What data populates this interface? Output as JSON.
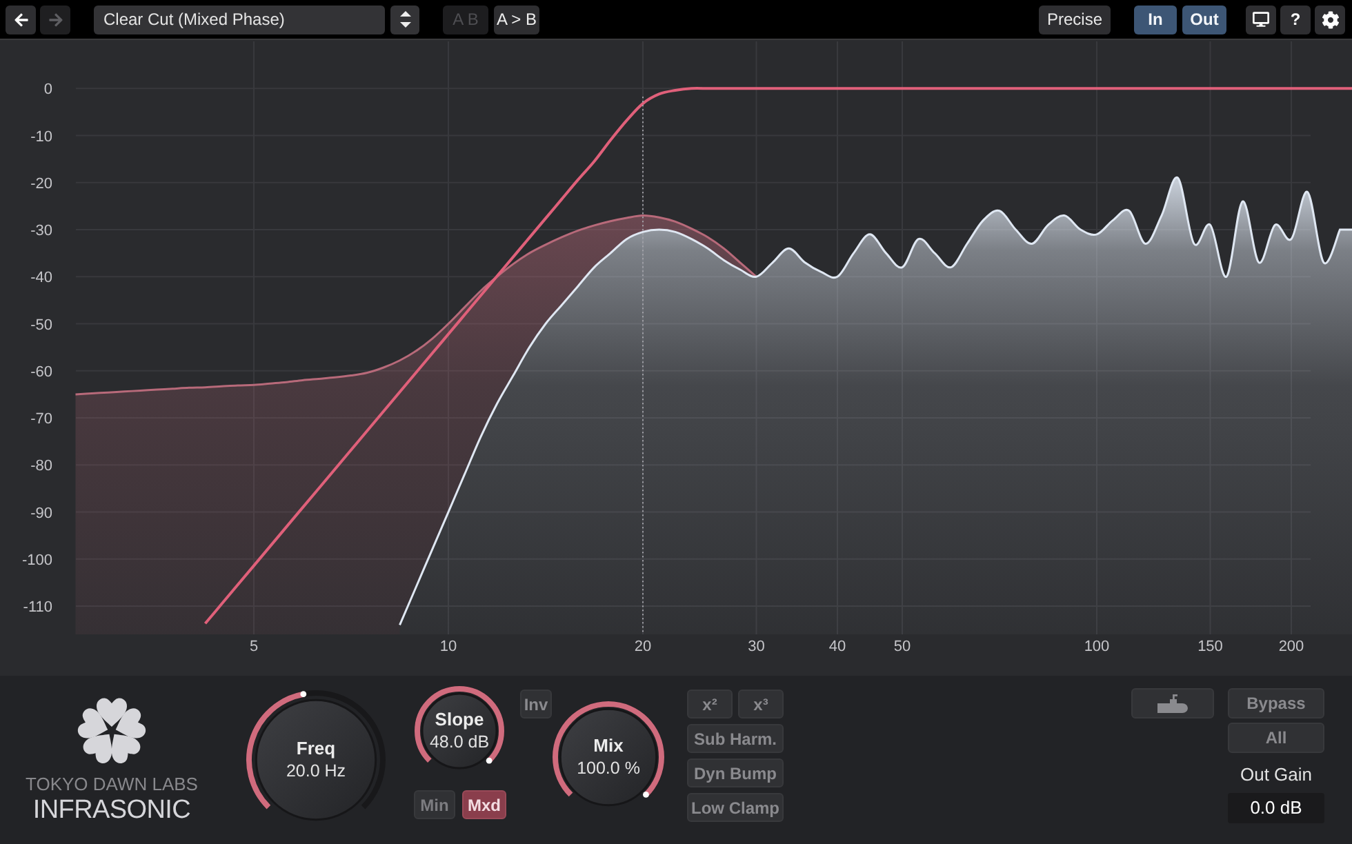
{
  "toolbar": {
    "navigation": [
      {
        "kind": "back",
        "disabled": false
      },
      {
        "kind": "forward",
        "disabled": true
      }
    ],
    "preset": {
      "value": "Clear Cut (Mixed Phase)"
    },
    "compare": [
      {
        "label": "A B",
        "disabled": true
      },
      {
        "label": "A > B",
        "disabled": false
      }
    ],
    "precise": {
      "label": "Precise"
    },
    "analyzer": [
      {
        "label": "In",
        "on": true
      },
      {
        "label": "Out",
        "on": true
      }
    ],
    "help": {
      "label": "?"
    }
  },
  "graph": {
    "chart_data": {
      "type": "line",
      "grid": true,
      "categories": [
        null,
        null,
        null,
        null,
        null,
        null,
        null,
        null,
        null,
        null,
        null,
        "5",
        null,
        null,
        null,
        null,
        null,
        null,
        null,
        null,
        null,
        null,
        null,
        "10",
        null,
        null,
        null,
        null,
        null,
        null,
        null,
        null,
        null,
        null,
        null,
        "20",
        null,
        null,
        null,
        null,
        null,
        null,
        "30",
        null,
        null,
        null,
        null,
        "40",
        null,
        null,
        null,
        "50",
        null,
        null,
        null,
        null,
        null,
        null,
        null,
        null,
        null,
        null,
        null,
        "100",
        null,
        null,
        null,
        null,
        null,
        null,
        "150",
        null,
        null,
        null,
        null,
        "200",
        null,
        null,
        null
      ],
      "ylim": [
        -116,
        10
      ],
      "yticks": [
        0,
        -10,
        -20,
        -30,
        -40,
        -50,
        -60,
        -70,
        -80,
        -90,
        -100,
        -110
      ],
      "series": [
        {
          "color": "#b86a7a",
          "values": [
            -65,
            -64.8,
            -64.6,
            -64.4,
            -64.2,
            -64,
            -63.8,
            -63.6,
            -63.5,
            -63.3,
            -63.1,
            -63,
            -62.7,
            -62.4,
            -62,
            -61.7,
            -61.4,
            -61,
            -60.4,
            -59.3,
            -57.8,
            -55.8,
            -53.2,
            -50,
            -46.5,
            -43,
            -40,
            -37.3,
            -35,
            -33.2,
            -31.6,
            -30.2,
            -29.1,
            -28.2,
            -27.5,
            -27,
            -27.4,
            -28.3,
            -29.8,
            -31.6,
            -34,
            -37,
            -40,
            null,
            null,
            null,
            null,
            null,
            null,
            null,
            null,
            null,
            null,
            null,
            null,
            null,
            null,
            null,
            null,
            null,
            null,
            null,
            null,
            null,
            null,
            null,
            null,
            null,
            null,
            null,
            null,
            null,
            null,
            null,
            null,
            null,
            null,
            null,
            null
          ]
        },
        {
          "color": "#dfe7f2",
          "values": [
            null,
            null,
            null,
            null,
            null,
            null,
            null,
            null,
            null,
            null,
            null,
            null,
            null,
            null,
            null,
            null,
            null,
            null,
            null,
            null,
            -114,
            -106,
            -98,
            -90,
            -82,
            -74,
            -67,
            -61,
            -55,
            -50,
            -46,
            -42,
            -38,
            -35,
            -32,
            -30.5,
            -30,
            -30.5,
            -32,
            -34,
            -36.5,
            -38.5,
            -40,
            -37,
            -34,
            -37,
            -39,
            -40,
            -35,
            -31,
            -35,
            -38,
            -32,
            -35,
            -38,
            -33,
            -28,
            -26,
            -30,
            -33,
            -29,
            -27,
            -30,
            -31,
            -28,
            -26,
            -33,
            -27,
            -19,
            -33,
            -29,
            -40,
            -24,
            -37,
            -29,
            -32,
            -22,
            -37,
            -30
          ]
        },
        {
          "color": "#e0607a",
          "values": [
            null,
            null,
            null,
            null,
            null,
            null,
            null,
            null,
            -113.7,
            -109.6,
            -105.5,
            -101.4,
            -97.3,
            -93.2,
            -89.1,
            -85,
            -80.9,
            -76.8,
            -72.7,
            -68.6,
            -64.5,
            -60.4,
            -56.3,
            -52.2,
            -48.1,
            -44,
            -39.9,
            -35.8,
            -31.7,
            -27.6,
            -23.5,
            -19.4,
            -15.5,
            -11,
            -6.8,
            -3.2,
            -1.2,
            -0.4,
            0,
            0,
            0,
            0,
            0,
            0,
            0,
            0,
            0,
            0,
            0,
            0,
            0,
            0,
            0,
            0,
            0,
            0,
            0,
            0,
            0,
            0,
            0,
            0,
            0,
            0,
            0,
            0,
            0,
            0,
            0,
            0,
            0,
            0,
            0,
            0,
            0,
            0,
            0,
            0,
            0
          ]
        }
      ],
      "ref_lines": [
        {
          "axis": "x",
          "value": "20"
        }
      ]
    }
  },
  "logo": {
    "maker": "TOKYO DAWN LABS",
    "product": "INFRASONIC"
  },
  "knobs": [
    {
      "label": "Freq",
      "value": "20.0 Hz",
      "level": 0.46
    },
    {
      "label": "Slope",
      "value": "48.0 dB",
      "level": 1
    },
    {
      "label": "Mix",
      "value": "100.0 %",
      "level": 1
    }
  ],
  "phase_modes": [
    {
      "label": "Min",
      "selected": false
    },
    {
      "label": "Mxd",
      "selected": true
    }
  ],
  "inv": {
    "label": "Inv",
    "on": false
  },
  "harmonics": [
    {
      "label": "x²",
      "on": false
    },
    {
      "label": "x³",
      "on": false
    }
  ],
  "options": [
    {
      "label": "Sub Harm.",
      "on": false
    },
    {
      "label": "Dyn Bump",
      "on": false
    },
    {
      "label": "Low Clamp",
      "on": false
    }
  ],
  "icon_toggle": {
    "on": false
  },
  "bypass": [
    {
      "label": "Bypass",
      "on": false
    },
    {
      "label": "All",
      "on": false
    }
  ],
  "out_gain": {
    "label": "Out Gain",
    "value": "0.0 dB"
  }
}
